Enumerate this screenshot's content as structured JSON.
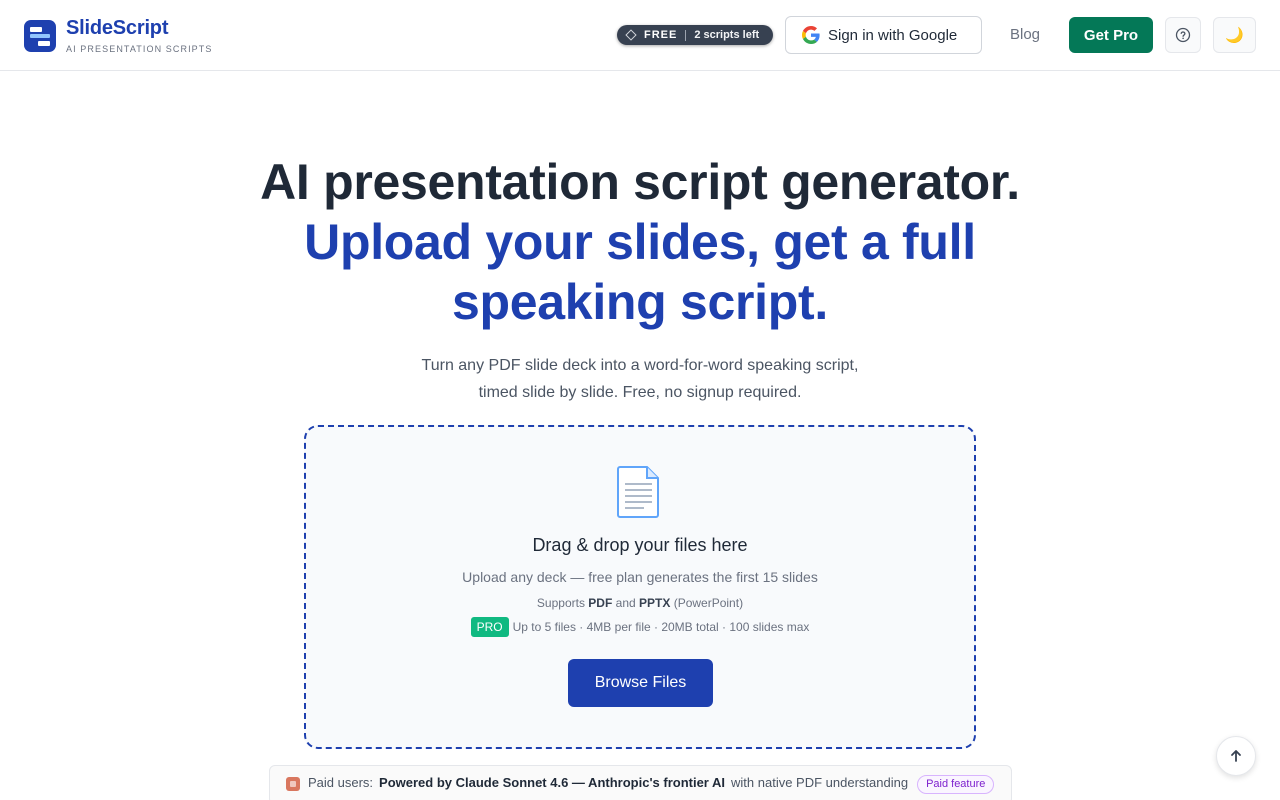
{
  "brand": {
    "name": "SlideScript",
    "tagline": "AI PRESENTATION SCRIPTS"
  },
  "header": {
    "plan_label": "FREE",
    "scripts_left": "2 scripts left",
    "google_signin": "Sign in with Google",
    "blog": "Blog",
    "get_pro": "Get Pro",
    "theme_icon": "🌙"
  },
  "hero": {
    "title_line1": "AI presentation script generator.",
    "title_line2": "Upload your slides, get a full speaking script.",
    "subtitle_line1": "Turn any PDF slide deck into a word-for-word speaking script,",
    "subtitle_line2": "timed slide by slide. Free, no signup required."
  },
  "dropzone": {
    "title": "Drag & drop your files here",
    "line1": "Upload any deck — free plan generates the first 15 slides",
    "supports_prefix": "Supports",
    "format_pdf": "PDF",
    "and": "and",
    "format_pptx": "PPTX",
    "pptx_note": "(PowerPoint)",
    "pro_badge": "PRO",
    "pro_limits": "Up to 5 files · 4MB per file · 20MB total · 100 slides max",
    "browse": "Browse Files"
  },
  "paid_banner": {
    "prefix": "Paid users:",
    "highlight": "Powered by Claude Sonnet 4.6 — Anthropic's frontier AI",
    "suffix": "with native PDF understanding",
    "pill": "Paid feature"
  },
  "colors": {
    "brand_blue": "#1e40af",
    "pro_green": "#047857",
    "pro_badge_green": "#10b981"
  }
}
